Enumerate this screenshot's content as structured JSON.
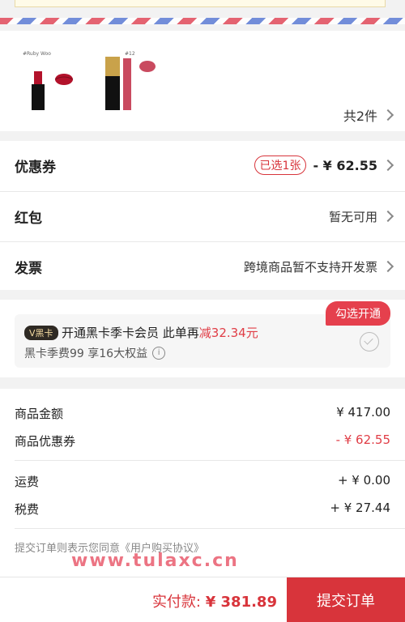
{
  "products": {
    "items": [
      {
        "name": "#Ruby Woo",
        "color": "#b3122b"
      },
      {
        "name": "#12",
        "color": "#c94a5f"
      }
    ],
    "count_label": "共2件"
  },
  "rows": [
    {
      "label": "优惠券",
      "badge": "已选1张",
      "value": "- ¥ 62.55"
    },
    {
      "label": "红包",
      "value": "暂无可用"
    },
    {
      "label": "发票",
      "value": "跨境商品暂不支持开发票"
    }
  ],
  "member": {
    "tag": "V黑卡",
    "title_prefix": "开通黑卡季卡会员  此单再",
    "title_highlight": "减32.34元",
    "subtitle": "黑卡季费99 享16大权益",
    "open_button": "勾选开通"
  },
  "summary": {
    "goods_label": "商品金额",
    "goods_value": "¥ 417.00",
    "coupon_label": "商品优惠券",
    "coupon_value": "- ¥ 62.55",
    "freight_label": "运费",
    "freight_value": "+ ¥ 0.00",
    "tax_label": "税费",
    "tax_value": "+ ¥ 27.44",
    "agreement": "提交订单则表示您同意《用户购买协议》",
    "watermark": "www.tulaxc.cn"
  },
  "bottom": {
    "pay_label": "实付款: ",
    "pay_value": "¥ 381.89",
    "submit": "提交订单"
  },
  "colors": {
    "accent": "#d8343b",
    "member_red": "#e5404d"
  }
}
